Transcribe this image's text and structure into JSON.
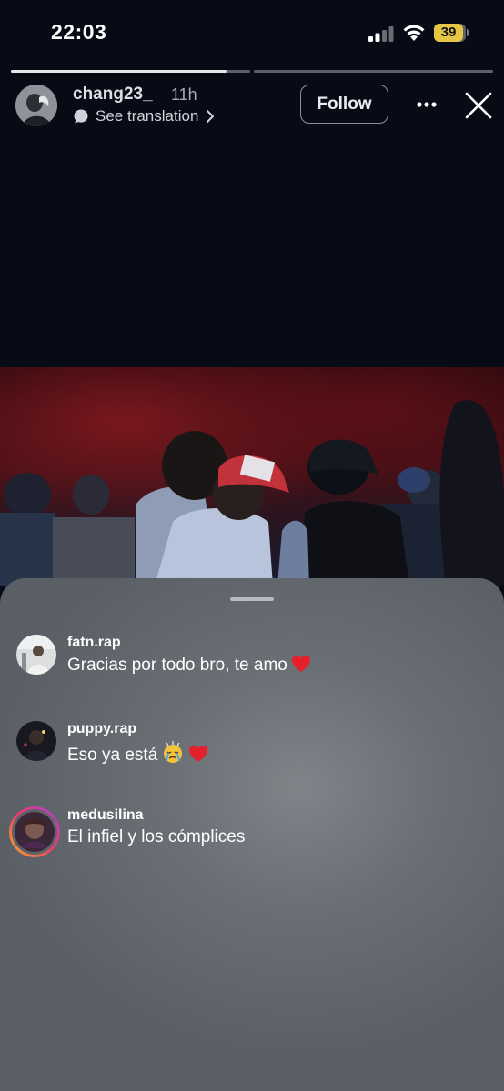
{
  "status_bar": {
    "time": "22:03",
    "battery_level": "39",
    "battery_color": "#e5c544",
    "icons": [
      "signal-icon",
      "wifi-icon",
      "battery-icon"
    ]
  },
  "story": {
    "progress_segments": [
      0.9,
      0
    ],
    "username": "chang23_",
    "time_ago": "11h",
    "see_translation_label": "See translation",
    "follow_label": "Follow",
    "icons": [
      "translate-bubble-icon",
      "chevron-right-icon",
      "more-icon",
      "close-icon"
    ]
  },
  "comments": [
    {
      "username": "fatn.rap",
      "text": "Gracias por todo bro, te amo",
      "emoji": [
        "red-heart"
      ]
    },
    {
      "username": "puppy.rap",
      "text": "Eso ya está",
      "emoji": [
        "crying-face",
        "red-heart"
      ]
    },
    {
      "username": "medusilina",
      "text": "El infiel y los cómplices",
      "emoji": [],
      "story_ring": true
    }
  ]
}
